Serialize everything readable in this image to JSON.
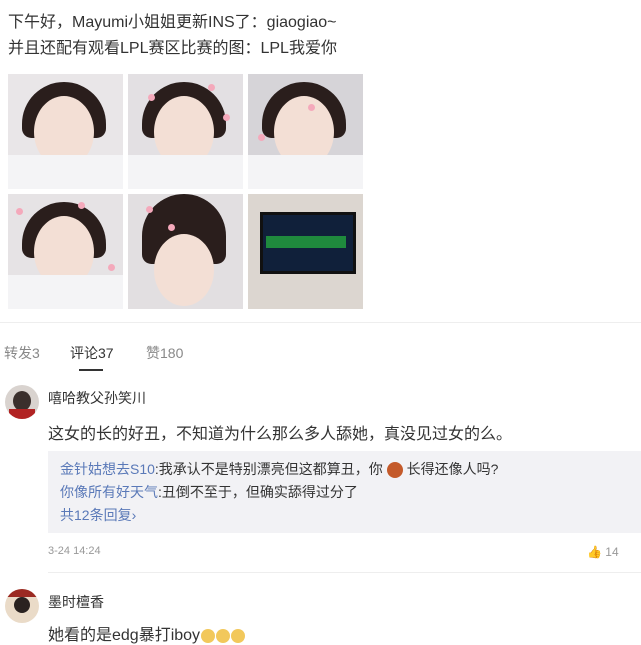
{
  "post": {
    "line1": "下午好，Mayumi小姐姐更新INS了：giaogiao~",
    "line2": "并且还配有观看LPL赛区比赛的图：LPL我爱你"
  },
  "tabs": {
    "repost": "转发3",
    "comments": "评论37",
    "likes": "赞180"
  },
  "comments": [
    {
      "user": "嘻哈教父孙笑川",
      "text": "这女的长的好丑，不知道为什么那么多人舔她，真没见过女的么。",
      "replies": [
        {
          "user": "金针姑想去S10",
          "text": ":我承认不是特别漂亮但这都算丑，你",
          "text2": "长得还像人吗?"
        },
        {
          "user": "你像所有好天气",
          "text": ":丑倒不至于，但确实舔得过分了"
        }
      ],
      "more": "共12条回复",
      "time": "3-24 14:24",
      "likes": "14"
    },
    {
      "user": "墨时檀香",
      "text": "她看的是edg暴打iboy"
    }
  ],
  "colors": {
    "link": "#5a79b8",
    "text": "#333333",
    "muted": "#999999"
  }
}
